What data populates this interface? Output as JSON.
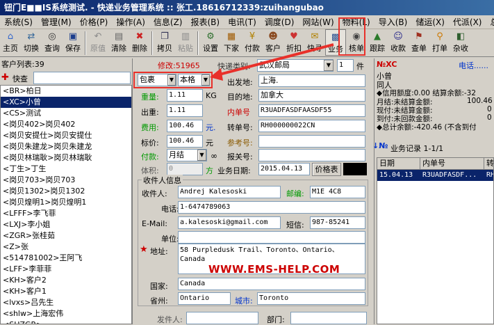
{
  "title": "钮门E■■IS系统测试. - 快递业务管理系统 :: 张工.18616712339:zuihangubao",
  "menu": [
    "系统(S)",
    "管理(M)",
    "价格(P)",
    "操作(A)",
    "信息(Z)",
    "报表(B)",
    "电讯(T)",
    "调度(D)",
    "网站(W)",
    "物料(L)",
    "导入(B)",
    "储运(X)",
    "代派(X)",
    "总公"
  ],
  "toolbar": [
    {
      "label": "主页",
      "icon": "home-icon",
      "glyph": "⌂",
      "color": "#3366cc"
    },
    {
      "label": "切换",
      "icon": "switch-icon",
      "glyph": "⇄",
      "color": "#336699"
    },
    {
      "label": "查询",
      "icon": "binoculars-icon",
      "glyph": "◎",
      "color": "#333"
    },
    {
      "label": "保存",
      "icon": "save-icon",
      "glyph": "▣",
      "color": "#1a3c8c"
    },
    {
      "label": "原值",
      "icon": "undo-icon",
      "glyph": "↶",
      "color": "#8a8a8a",
      "disabled": true
    },
    {
      "label": "清除",
      "icon": "clear-icon",
      "glyph": "▤",
      "color": "#666"
    },
    {
      "label": "删除",
      "icon": "delete-icon",
      "glyph": "✖",
      "color": "#cc2222"
    },
    {
      "label": "拷贝",
      "icon": "copy-icon",
      "glyph": "❐",
      "color": "#335"
    },
    {
      "label": "粘贴",
      "icon": "paste-icon",
      "glyph": "▥",
      "color": "#8a8a8a",
      "disabled": true
    },
    {
      "label": "设置",
      "icon": "settings-icon",
      "glyph": "⚙",
      "color": "#2f6f2f"
    },
    {
      "label": "下家",
      "icon": "next-party-icon",
      "glyph": "▦",
      "color": "#a05a00"
    },
    {
      "label": "付款",
      "icon": "payment-icon",
      "glyph": "¥",
      "color": "#b08000"
    },
    {
      "label": "客户",
      "icon": "customer-icon",
      "glyph": "☻",
      "color": "#8a4a20"
    },
    {
      "label": "折扣",
      "icon": "discount-icon",
      "glyph": "♥",
      "color": "#cc3333"
    },
    {
      "label": "快寻",
      "icon": "quick-find-icon",
      "glyph": "✉",
      "color": "#b08000"
    },
    {
      "label": "业务",
      "icon": "business-icon",
      "glyph": "▩",
      "color": "#2a4f8f",
      "active": true
    },
    {
      "label": "核单",
      "icon": "verify-icon",
      "glyph": "◉",
      "color": "#444"
    },
    {
      "label": "跟踪",
      "icon": "track-icon",
      "glyph": "▲",
      "color": "#2a7a2a"
    },
    {
      "label": "收款",
      "icon": "receive-icon",
      "glyph": "☺",
      "color": "#2a2a8a"
    },
    {
      "label": "查单",
      "icon": "lookup-icon",
      "glyph": "⚑",
      "color": "#a03020"
    },
    {
      "label": "打单",
      "icon": "print-icon",
      "glyph": "⚲",
      "color": "#cc7700"
    },
    {
      "label": "杂收",
      "icon": "misc-icon",
      "glyph": "◧",
      "color": "#2f5f2f"
    }
  ],
  "left": {
    "header": "客户列表:39",
    "search_label": "快查",
    "items": [
      "<BR>柏日",
      "<XC>小曾",
      "<CS>测试",
      "<岗贝402>岗贝402",
      "<岗贝安提仕>岗贝安提仕",
      "<岗贝朱建龙>岗贝朱建龙",
      "<岗贝林瑞耿>岗贝林瑞耿",
      "<丁生>丁生",
      "<岗贝703>岗贝703",
      "<岗贝1302>岗贝1302",
      "<岗贝煌明1>岗贝煌明1",
      "<LFFF>李飞菲",
      "<LXJ>李小姐",
      "<ZGR>张桂茹",
      "<Z>张",
      "<514781002>王阿飞",
      "<LFF>李菲菲",
      "<KH>客户2",
      "<KH>客户1",
      "<lvxs>吕先生",
      "<shlw>上海宏伟",
      "<SHZGR>"
    ],
    "selected_index": 1
  },
  "form": {
    "edit_label": "修改:51965",
    "service_label": "快递类别:",
    "service_value": "武汉邮局",
    "pieces_value": "1",
    "pieces_unit": "件",
    "pack_type": "包裹",
    "pack_sub": "本格",
    "weight_label": "重量:",
    "weight_value": "1.11",
    "weight_unit": "KG",
    "out_weight_label": "出重:",
    "out_weight_value": "1.11",
    "fee_label": "费用:",
    "fee_value": "100.46",
    "fee_unit": "元.",
    "price_label": "标价:",
    "price_value": "100.46",
    "price_unit": "元",
    "pay_label": "付款:",
    "pay_value": "月结",
    "volume_label": "体积:",
    "volume_value": "0",
    "volume_unit": "方",
    "origin_label": "出发地:",
    "origin_value": "上海.",
    "dest_label": "目的地:",
    "dest_value": "加拿大",
    "inner_label": "内单号",
    "inner_value": "R3UADFASDFAASDF55",
    "transfer_label": "转单号:",
    "transfer_value": "RH000000022CN",
    "ref_label": "参考号:",
    "ref_value": "",
    "customs_label": "报关号:",
    "customs_value": "",
    "date_label": "业务日期:",
    "date_value": "2015.04.13",
    "price_table_button": "价格表"
  },
  "recipient": {
    "section_title": "收件人信息",
    "name_label": "收件人:",
    "name_value": "Andrej Kalesoski",
    "postcode_label": "邮编:",
    "postcode_value": "M1E 4C8",
    "phone_label": "电话:",
    "phone_value": "1-6474789063",
    "email_label": "E-Mail:",
    "email_value": "a.kalesoski@gmail.com",
    "sms_label": "短信:",
    "sms_value": "987-85241",
    "company_label": "单位:",
    "company_value": "",
    "address_label": "地址:",
    "address_value": "58 Purpledusk Trail、Toronto、Ontario、Canada",
    "country_label": "国家:",
    "country_value": "Canada",
    "province_label": "省州:",
    "province_value": "Ontario",
    "city_label": "城市:",
    "city_value": "Toronto",
    "watermark": "WWW.EMS-HELP.COM"
  },
  "sender": {
    "sender_label": "发件人:",
    "dept_label": "部门:"
  },
  "right": {
    "code": "№XC",
    "phone_link": "电话......",
    "name": "小曾",
    "same": "同人",
    "credit": "◆信用额度:0.00 结算余额:-32",
    "unsettled": "月结:未结算金额:",
    "unsettled_value": "100.46",
    "cash": "现付:未结算金额:",
    "cash_value": "0",
    "cod": "到付:未回款金额:",
    "cod_value": "0",
    "total": "◆总计余额:-420.46 (不含到付",
    "records_title": "业务记录 1-1/1",
    "columns": [
      "日期",
      "内单号",
      "转"
    ],
    "rows": [
      [
        "15.04.13",
        "R3UADFASDF...",
        "RH"
      ]
    ]
  },
  "colors": {
    "accent": "#e8302a",
    "selection": "#0a246a",
    "link": "#0033cc"
  }
}
